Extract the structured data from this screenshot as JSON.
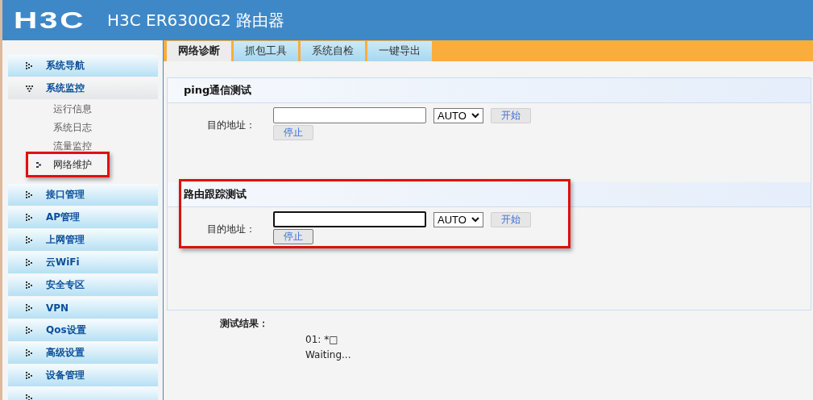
{
  "header": {
    "logo": "H3C",
    "title": "H3C ER6300G2 路由器"
  },
  "sidebar": {
    "items": [
      {
        "label": "系统导航",
        "expanded": false
      },
      {
        "label": "系统监控",
        "expanded": true,
        "children": [
          {
            "label": "运行信息",
            "selected": false,
            "highlighted": false
          },
          {
            "label": "系统日志",
            "selected": false,
            "highlighted": false
          },
          {
            "label": "流量监控",
            "selected": false,
            "highlighted": false
          },
          {
            "label": "网络维护",
            "selected": true,
            "highlighted": true
          }
        ]
      },
      {
        "label": "接口管理",
        "expanded": false
      },
      {
        "label": "AP管理",
        "expanded": false
      },
      {
        "label": "上网管理",
        "expanded": false
      },
      {
        "label": "云WiFi",
        "expanded": false
      },
      {
        "label": "安全专区",
        "expanded": false
      },
      {
        "label": "VPN",
        "expanded": false
      },
      {
        "label": "Qos设置",
        "expanded": false
      },
      {
        "label": "高级设置",
        "expanded": false
      },
      {
        "label": "设备管理",
        "expanded": false
      },
      {
        "expanded": false
      }
    ]
  },
  "tabs": [
    {
      "label": "网络诊断",
      "selected": true
    },
    {
      "label": "抓包工具",
      "selected": false
    },
    {
      "label": "系统自检",
      "selected": false
    },
    {
      "label": "一键导出",
      "selected": false
    }
  ],
  "sections": [
    {
      "title": "ping通信测试",
      "address_label": "目的地址：",
      "select_value": "AUTO",
      "start_button": "开始",
      "stop_button": "停止",
      "focused": false,
      "highlighted": false
    },
    {
      "title": "路由跟踪测试",
      "address_label": "目的地址：",
      "select_value": "AUTO",
      "start_button": "开始",
      "stop_button": "停止",
      "focused": true,
      "highlighted": true
    }
  ],
  "result": {
    "label": "测试结果：",
    "lines": [
      "01: *□",
      "Waiting..."
    ]
  }
}
